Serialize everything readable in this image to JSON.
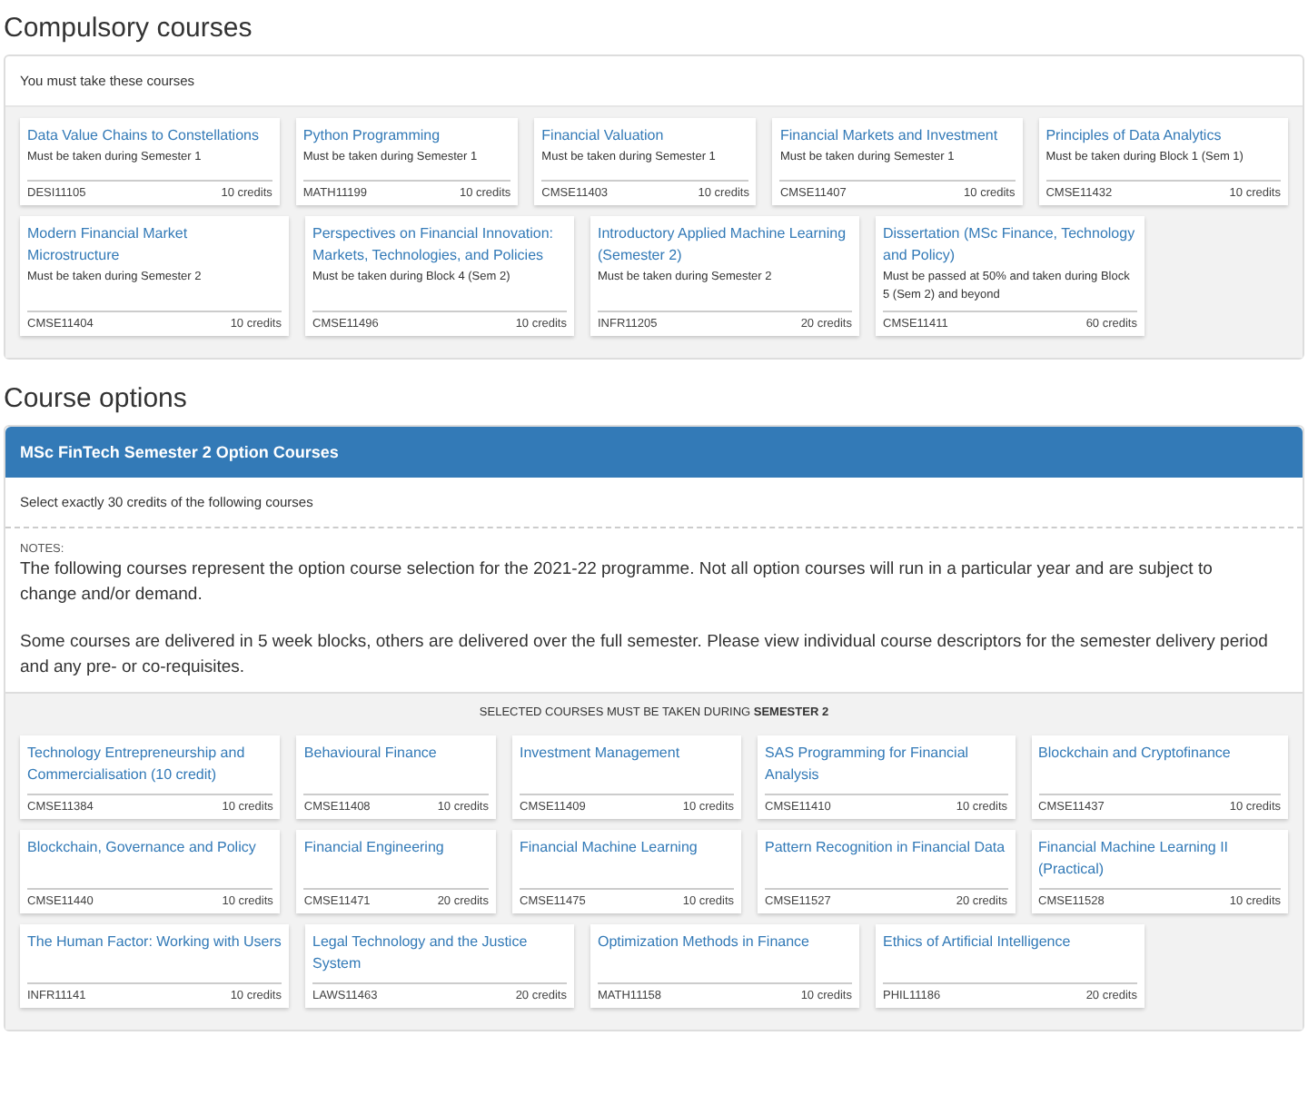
{
  "compulsory": {
    "heading": "Compulsory courses",
    "instruction": "You must take these courses",
    "rows": [
      [
        {
          "title": "Data Value Chains to Constellations",
          "note": "Must be taken during Semester 1",
          "code": "DESI11105",
          "credits": "10 credits"
        },
        {
          "title": "Python Programming",
          "note": "Must be taken during Semester 1",
          "code": "MATH11199",
          "credits": "10 credits"
        },
        {
          "title": "Financial Valuation",
          "note": "Must be taken during Semester 1",
          "code": "CMSE11403",
          "credits": "10 credits"
        },
        {
          "title": "Financial Markets and Investment",
          "note": "Must be taken during Semester 1",
          "code": "CMSE11407",
          "credits": "10 credits"
        },
        {
          "title": "Principles of Data Analytics",
          "note": "Must be taken during Block 1 (Sem 1)",
          "code": "CMSE11432",
          "credits": "10 credits"
        }
      ],
      [
        {
          "title": "Modern Financial Market Microstructure",
          "note": "Must be taken during Semester 2",
          "code": "CMSE11404",
          "credits": "10 credits"
        },
        {
          "title": "Perspectives on Financial Innovation: Markets, Technologies, and Policies",
          "note": "Must be taken during Block 4 (Sem 2)",
          "code": "CMSE11496",
          "credits": "10 credits"
        },
        {
          "title": "Introductory Applied Machine Learning (Semester 2)",
          "note": "Must be taken during Semester 2",
          "code": "INFR11205",
          "credits": "20 credits"
        },
        {
          "title": "Dissertation (MSc Finance, Technology and Policy)",
          "note": "Must be passed at 50% and taken during Block 5 (Sem 2) and beyond",
          "code": "CMSE11411",
          "credits": "60 credits"
        }
      ]
    ]
  },
  "options": {
    "heading": "Course options",
    "panel_title": "MSc FinTech Semester 2 Option Courses",
    "instruction": "Select exactly 30 credits of the following courses",
    "notes_label": "NOTES:",
    "notes": [
      "The following courses represent the option course selection for the 2021-22 programme. Not all option courses will run in a particular year and are subject to change and/or demand.",
      "Some courses are delivered in 5 week blocks, others are delivered over the full semester. Please view individual course descriptors for the semester delivery period and any pre- or co-requisites."
    ],
    "group_heading": "SELECTED COURSES MUST BE TAKEN DURING **SEMESTER 2**",
    "rows": [
      [
        {
          "title": "Technology Entrepreneurship and Commercialisation (10 credit)",
          "code": "CMSE11384",
          "credits": "10 credits"
        },
        {
          "title": "Behavioural Finance",
          "code": "CMSE11408",
          "credits": "10 credits"
        },
        {
          "title": "Investment Management",
          "code": "CMSE11409",
          "credits": "10 credits"
        },
        {
          "title": "SAS Programming for Financial Analysis",
          "code": "CMSE11410",
          "credits": "10 credits"
        },
        {
          "title": "Blockchain and Cryptofinance",
          "code": "CMSE11437",
          "credits": "10 credits"
        }
      ],
      [
        {
          "title": "Blockchain, Governance and Policy",
          "code": "CMSE11440",
          "credits": "10 credits"
        },
        {
          "title": "Financial Engineering",
          "code": "CMSE11471",
          "credits": "20 credits"
        },
        {
          "title": "Financial Machine Learning",
          "code": "CMSE11475",
          "credits": "10 credits"
        },
        {
          "title": "Pattern Recognition in Financial Data",
          "code": "CMSE11527",
          "credits": "20 credits"
        },
        {
          "title": "Financial Machine Learning II (Practical)",
          "code": "CMSE11528",
          "credits": "10 credits"
        }
      ],
      [
        {
          "title": "The Human Factor: Working with Users",
          "code": "INFR11141",
          "credits": "10 credits"
        },
        {
          "title": "Legal Technology and the Justice System",
          "code": "LAWS11463",
          "credits": "20 credits"
        },
        {
          "title": "Optimization Methods in Finance",
          "code": "MATH11158",
          "credits": "10 credits"
        },
        {
          "title": "Ethics of Artificial Intelligence",
          "code": "PHIL11186",
          "credits": "20 credits"
        }
      ]
    ]
  }
}
